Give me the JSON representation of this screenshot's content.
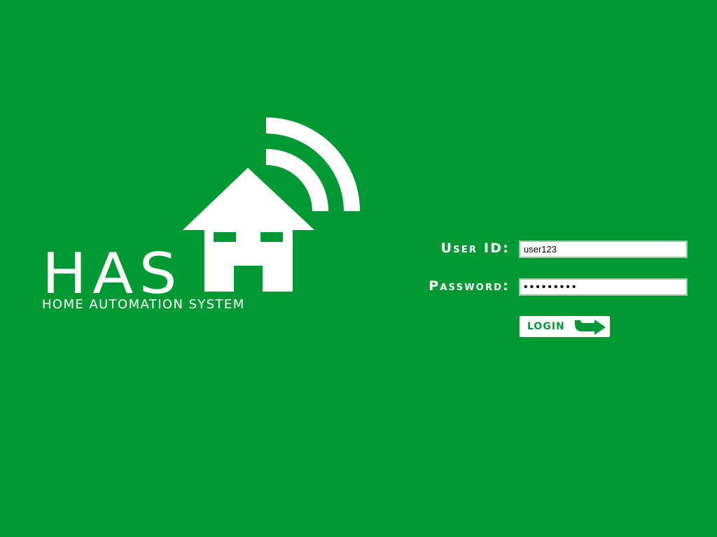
{
  "logo": {
    "title": "HAS",
    "tagline": "HOME AUTOMATION SYSTEM",
    "icon": "house-wifi-icon"
  },
  "login_form": {
    "user_id_label": "User ID:",
    "user_id_value": "user123",
    "password_label": "Password:",
    "password_value": "•••••••••",
    "login_button_label": "LOGIN",
    "login_button_icon": "arrow-right-icon"
  },
  "colors": {
    "background": "#009933",
    "text": "#ffffff",
    "accent": "#009933"
  }
}
